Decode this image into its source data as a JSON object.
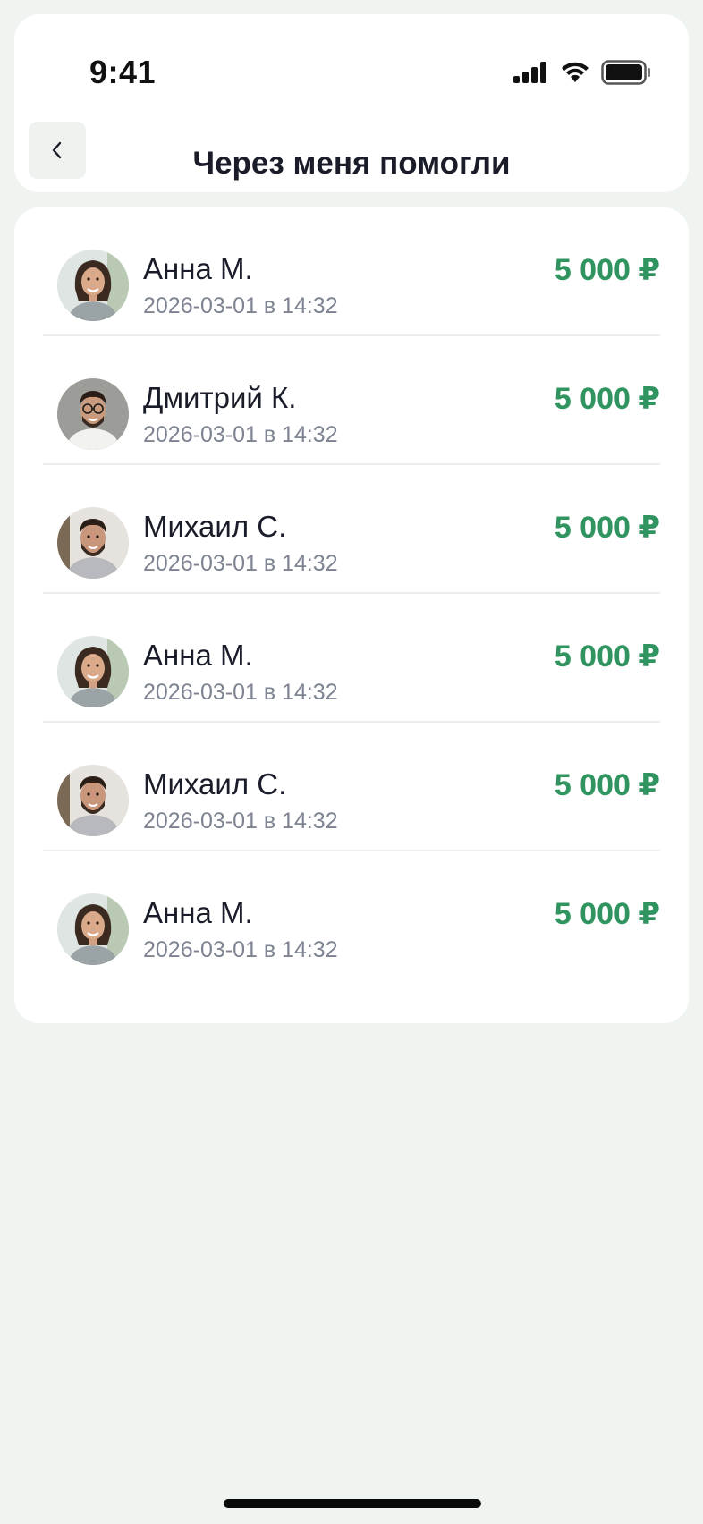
{
  "status_bar": {
    "time": "9:41"
  },
  "header": {
    "title": "Через меня помогли"
  },
  "donations": [
    {
      "name": "Анна М.",
      "date": "2026-03-01 в 14:32",
      "amount": "5 000 ₽",
      "avatar": "woman"
    },
    {
      "name": "Дмитрий К.",
      "date": "2026-03-01 в 14:32",
      "amount": "5 000 ₽",
      "avatar": "man-glasses"
    },
    {
      "name": "Михаил С.",
      "date": "2026-03-01 в 14:32",
      "amount": "5 000 ₽",
      "avatar": "man-beard"
    },
    {
      "name": "Анна М.",
      "date": "2026-03-01 в 14:32",
      "amount": "5 000 ₽",
      "avatar": "woman"
    },
    {
      "name": "Михаил С.",
      "date": "2026-03-01 в 14:32",
      "amount": "5 000 ₽",
      "avatar": "man-beard"
    },
    {
      "name": "Анна М.",
      "date": "2026-03-01 в 14:32",
      "amount": "5 000 ₽",
      "avatar": "woman"
    }
  ],
  "colors": {
    "accent": "#2f9460",
    "background": "#f0f4f1"
  }
}
